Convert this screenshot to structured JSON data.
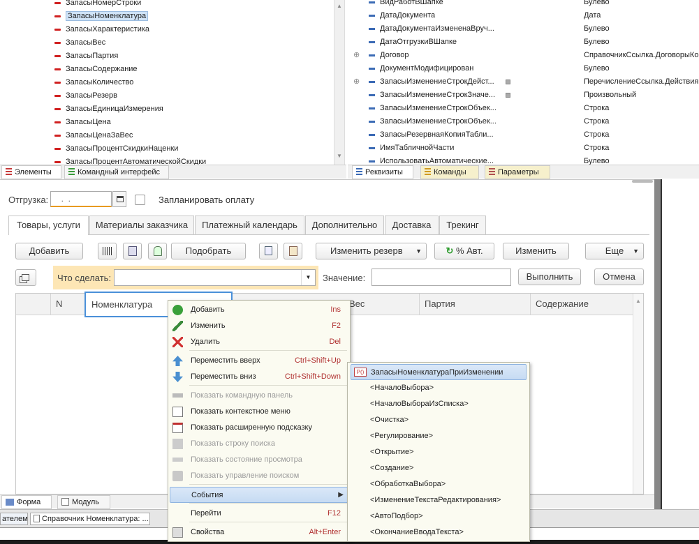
{
  "left_tree": {
    "items": [
      "ЗапасыНомерСтроки",
      "ЗапасыНоменклатура",
      "ЗапасыХарактеристика",
      "ЗапасыВес",
      "ЗапасыПартия",
      "ЗапасыСодержание",
      "ЗапасыКоличество",
      "ЗапасыРезерв",
      "ЗапасыЕдиницаИзмерения",
      "ЗапасыЦена",
      "ЗапасыЦенаЗаВес",
      "ЗапасыПроцентСкидкиНаценки",
      "ЗапасыПроцентАвтоматическойСкидки"
    ],
    "selected": "ЗапасыНоменклатура"
  },
  "left_tabs": [
    "Элементы",
    "Командный интерфейс"
  ],
  "right_props": {
    "rows": [
      {
        "name": "ВидРаботВШапке",
        "type": "Булево"
      },
      {
        "name": "ДатаДокумента",
        "type": "Дата"
      },
      {
        "name": "ДатаДокументаИзмененаВруч...",
        "type": "Булево"
      },
      {
        "name": "ДатаОтгрузкиВШапке",
        "type": "Булево"
      },
      {
        "name": "Договор",
        "type": "СправочникСсылка.ДоговорыКо"
      },
      {
        "name": "ДокументМодифицирован",
        "type": "Булево"
      },
      {
        "name": "ЗапасыИзменениеСтрокДейст...",
        "type": "ПеречислениеСсылка.Действия"
      },
      {
        "name": "ЗапасыИзменениеСтрокЗначе...",
        "type": "Произвольный"
      },
      {
        "name": "ЗапасыИзменениеСтрокОбъек...",
        "type": "Строка"
      },
      {
        "name": "ЗапасыИзменениеСтрокОбъек...",
        "type": "Строка"
      },
      {
        "name": "ЗапасыРезервнаяКопияТабли...",
        "type": "Строка"
      },
      {
        "name": "ИмяТабличнойЧасти",
        "type": "Строка"
      },
      {
        "name": "ИспользоватьАвтоматические...",
        "type": "Булево"
      }
    ]
  },
  "right_tabs": [
    "Реквизиты",
    "Команды",
    "Параметры"
  ],
  "shipment": {
    "label": "Отгрузка:",
    "value": "  .  .",
    "plan_label": "Запланировать оплату"
  },
  "form_tabs": [
    "Товары, услуги",
    "Материалы заказчика",
    "Платежный календарь",
    "Дополнительно",
    "Доставка",
    "Трекинг"
  ],
  "toolbar": {
    "add": "Добавить",
    "pick": "Подобрать",
    "change_reserve": "Изменить резерв",
    "auto_pct": "% Авт.",
    "change": "Изменить",
    "more": "Еще"
  },
  "action_bar": {
    "what_to_do": "Что сделать:",
    "value": "Значение:",
    "execute": "Выполнить",
    "cancel": "Отмена"
  },
  "table": {
    "columns": [
      "N",
      "Номенклатура",
      "Вес",
      "Партия",
      "Содержание"
    ]
  },
  "context_menu": {
    "items": [
      {
        "label": "Добавить",
        "shortcut": "Ins",
        "icon": "add-icon",
        "enabled": true
      },
      {
        "label": "Изменить",
        "shortcut": "F2",
        "icon": "edit-icon",
        "enabled": true
      },
      {
        "label": "Удалить",
        "shortcut": "Del",
        "icon": "delete-icon",
        "enabled": true
      },
      {
        "label": "Переместить вверх",
        "shortcut": "Ctrl+Shift+Up",
        "icon": "arrow-up-icon",
        "enabled": true
      },
      {
        "label": "Переместить вниз",
        "shortcut": "Ctrl+Shift+Down",
        "icon": "arrow-down-icon",
        "enabled": true
      },
      {
        "label": "Показать командную панель",
        "shortcut": "",
        "icon": "command-panel-icon",
        "enabled": false
      },
      {
        "label": "Показать контекстное меню",
        "shortcut": "",
        "icon": "context-menu-icon",
        "enabled": true
      },
      {
        "label": "Показать расширенную подсказку",
        "shortcut": "",
        "icon": "tooltip-icon",
        "enabled": true
      },
      {
        "label": "Показать строку поиска",
        "shortcut": "",
        "icon": "search-bar-icon",
        "enabled": false
      },
      {
        "label": "Показать состояние просмотра",
        "shortcut": "",
        "icon": "view-state-icon",
        "enabled": false
      },
      {
        "label": "Показать управление поиском",
        "shortcut": "",
        "icon": "search-control-icon",
        "enabled": false
      },
      {
        "label": "События",
        "shortcut": "",
        "icon": "",
        "enabled": true
      },
      {
        "label": "Перейти",
        "shortcut": "F12",
        "icon": "",
        "enabled": true
      },
      {
        "label": "Свойства",
        "shortcut": "Alt+Enter",
        "icon": "properties-icon",
        "enabled": true
      }
    ]
  },
  "events_submenu": {
    "items": [
      "ЗапасыНоменклатураПриИзменении",
      "<НачалоВыбора>",
      "<НачалоВыбораИзСписка>",
      "<Очистка>",
      "<Регулирование>",
      "<Открытие>",
      "<Создание>",
      "<ОбработкаВыбора>",
      "<ИзменениеТекстаРедактирования>",
      "<АвтоПодбор>",
      "<ОкончаниеВводаТекста>"
    ],
    "first_icon": "P()"
  },
  "bottom_tabs": [
    "Форма",
    "Модуль"
  ],
  "taskbar": [
    "ателем...",
    "Справочник Номенклатура: ..."
  ],
  "colors": {
    "accent_blue": "#cfe3f7",
    "menu_bg": "#fbfbf1",
    "highlight_yellow": "#fde6b5"
  }
}
